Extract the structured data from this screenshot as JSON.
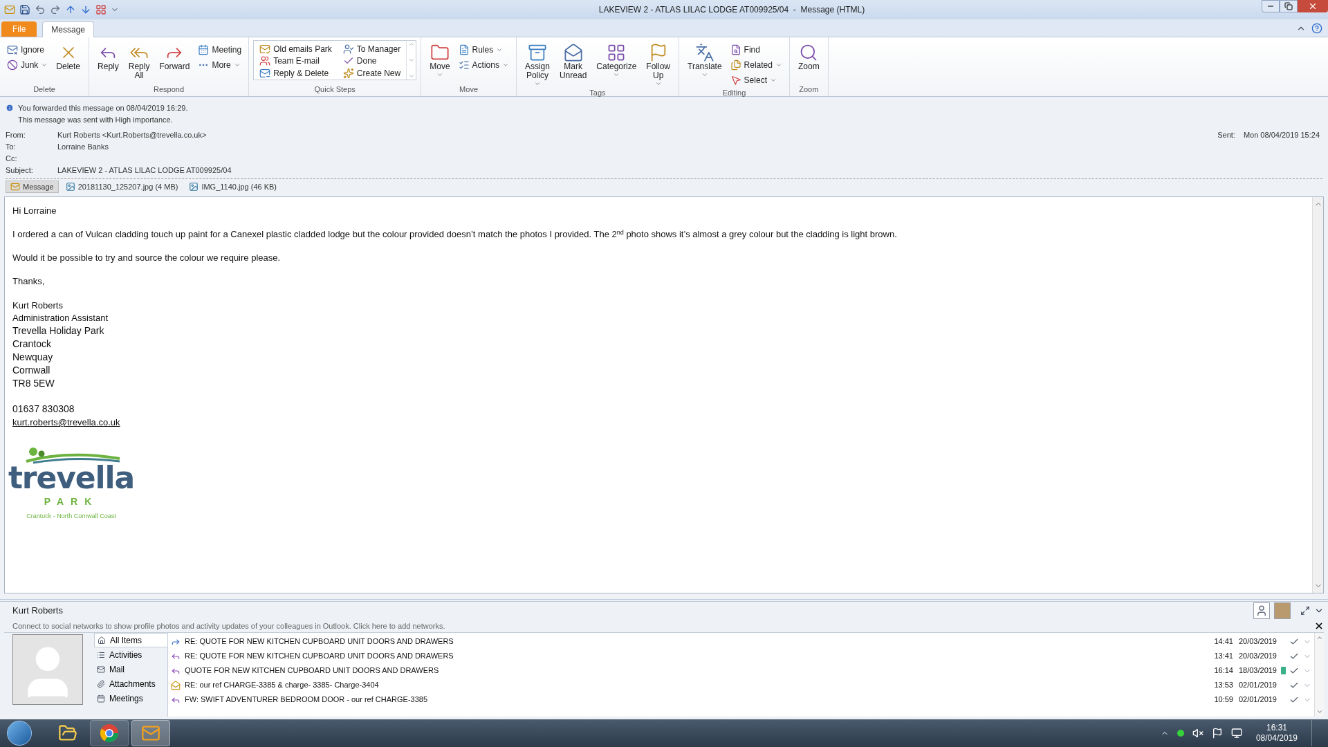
{
  "window": {
    "title": "LAKEVIEW 2 - ATLAS LILAC LODGE AT009925/04  -  Message (HTML)"
  },
  "ribbon_tabs": [
    {
      "label": "File",
      "kind": "file",
      "selected": false
    },
    {
      "label": "Message",
      "kind": "tab",
      "selected": true
    }
  ],
  "ribbon_groups": [
    {
      "label": "Delete",
      "kind": "buttons",
      "buttons": [
        {
          "label": "Ignore",
          "kind": "small",
          "dropdown": false
        },
        {
          "label": "Junk",
          "kind": "small",
          "dropdown": true
        },
        {
          "label": "Delete",
          "kind": "large",
          "dropdown": false
        }
      ]
    },
    {
      "label": "Respond",
      "kind": "buttons",
      "buttons": [
        {
          "label": "Reply",
          "kind": "large",
          "dropdown": false
        },
        {
          "label": "Reply All",
          "kind": "large",
          "dropdown": false
        },
        {
          "label": "Forward",
          "kind": "large",
          "dropdown": false
        },
        {
          "label": "Meeting",
          "kind": "small",
          "dropdown": false
        },
        {
          "label": "More",
          "kind": "small",
          "dropdown": true
        }
      ]
    },
    {
      "label": "Quick Steps",
      "kind": "quicksteps",
      "buttons": [
        {
          "label": "Old emails Park",
          "kind": "small",
          "dropdown": false
        },
        {
          "label": "Team E-mail",
          "kind": "small",
          "dropdown": false
        },
        {
          "label": "Reply & Delete",
          "kind": "small",
          "dropdown": false
        },
        {
          "label": "To Manager",
          "kind": "small",
          "dropdown": false
        },
        {
          "label": "Done",
          "kind": "small",
          "dropdown": false
        },
        {
          "label": "Create New",
          "kind": "small",
          "dropdown": false
        }
      ]
    },
    {
      "label": "Move",
      "kind": "buttons",
      "buttons": [
        {
          "label": "Move",
          "kind": "large",
          "dropdown": true
        },
        {
          "label": "Rules",
          "kind": "small",
          "dropdown": true
        },
        {
          "label": "Actions",
          "kind": "small",
          "dropdown": true
        }
      ]
    },
    {
      "label": "Tags",
      "kind": "buttons",
      "buttons": [
        {
          "label": "Assign Policy",
          "kind": "large",
          "dropdown": true
        },
        {
          "label": "Mark Unread",
          "kind": "large",
          "dropdown": false
        },
        {
          "label": "Categorize",
          "kind": "large",
          "dropdown": true
        },
        {
          "label": "Follow Up",
          "kind": "large",
          "dropdown": true
        }
      ]
    },
    {
      "label": "Editing",
      "kind": "buttons",
      "buttons": [
        {
          "label": "Translate",
          "kind": "large",
          "dropdown": true
        },
        {
          "label": "Find",
          "kind": "small",
          "dropdown": false
        },
        {
          "label": "Related",
          "kind": "small",
          "dropdown": true
        },
        {
          "label": "Select",
          "kind": "small",
          "dropdown": true
        }
      ]
    },
    {
      "label": "Zoom",
      "kind": "buttons",
      "buttons": [
        {
          "label": "Zoom",
          "kind": "large",
          "dropdown": false
        }
      ]
    }
  ],
  "info_bar": [
    "You forwarded this message on 08/04/2019 16:29.",
    "This message was sent with High importance."
  ],
  "header_fields": [
    {
      "label": "From:",
      "value": "Kurt Roberts <Kurt.Roberts@trevella.co.uk>"
    },
    {
      "label": "To:",
      "value": "Lorraine Banks"
    },
    {
      "label": "Cc:"
    },
    {
      "label": "Subject:",
      "value": "LAKEVIEW 2 - ATLAS LILAC LODGE AT009925/04"
    }
  ],
  "sent": {
    "label": "Sent:",
    "value": "Mon 08/04/2019 15:24"
  },
  "attachments": [
    {
      "label": "Message",
      "kind": "message",
      "selected": true
    },
    {
      "label": "20181130_125207.jpg (4 MB)",
      "kind": "image",
      "selected": false
    },
    {
      "label": "IMG_1140.jpg (46 KB)",
      "kind": "image",
      "selected": false
    }
  ],
  "body": {
    "paragraphs": [
      "Hi Lorraine",
      "I ordered a can of Vulcan cladding touch up paint for a Canexel plastic cladded lodge but the colour provided doesn’t match the photos I provided. The 2$^{nd}$ photo shows it’s almost a grey colour but the cladding is light brown.",
      "Would it be possible to try and source the colour we require please.",
      "Thanks,"
    ],
    "signature": [
      {
        "text": "Kurt Roberts",
        "kind": "small"
      },
      {
        "text": "Administration Assistant",
        "kind": "small"
      },
      {
        "text": "Trevella Holiday Park",
        "kind": "large"
      },
      {
        "text": "Crantock",
        "kind": "large"
      },
      {
        "text": "Newquay",
        "kind": "large"
      },
      {
        "text": "Cornwall",
        "kind": "large"
      },
      {
        "text": "TR8 5EW",
        "kind": "large"
      }
    ],
    "phone": "01637 830308",
    "email": "kurt.roberts@trevella.co.uk",
    "logo": {
      "name": "trevella",
      "sub": "PARK",
      "tagline": "Crantock - North Cornwall Coast"
    }
  },
  "people_pane": {
    "name": "Kurt Roberts",
    "notice": "Connect to social networks to show profile photos and activity updates of your colleagues in Outlook. Click here to add networks.",
    "tabs": [
      {
        "label": "All Items",
        "selected": true
      },
      {
        "label": "Activities",
        "selected": false
      },
      {
        "label": "Mail",
        "selected": false
      },
      {
        "label": "Attachments",
        "selected": false
      },
      {
        "label": "Meetings",
        "selected": false
      }
    ],
    "items": [
      {
        "subject": "RE: QUOTE FOR NEW KITCHEN CUPBOARD UNIT DOORS AND DRAWERS",
        "kind": "forwarded",
        "time": "14:41",
        "date": "20/03/2019"
      },
      {
        "subject": "RE: QUOTE FOR NEW KITCHEN CUPBOARD UNIT DOORS AND DRAWERS",
        "kind": "replied",
        "time": "13:41",
        "date": "20/03/2019"
      },
      {
        "subject": "QUOTE FOR NEW KITCHEN CUPBOARD UNIT DOORS AND DRAWERS",
        "kind": "replied",
        "time": "16:14",
        "date": "18/03/2019",
        "color": "#3cb08a"
      },
      {
        "subject": "RE: our ref CHARGE-3385 & charge- 3385- Charge-3404",
        "kind": "read",
        "time": "13:53",
        "date": "02/01/2019"
      },
      {
        "subject": "FW: SWIFT ADVENTURER BEDROOM DOOR - our ref CHARGE-3385",
        "kind": "replied",
        "time": "10:59",
        "date": "02/01/2019"
      }
    ]
  },
  "taskbar": {
    "time": "16:31",
    "date": "08/04/2019"
  }
}
